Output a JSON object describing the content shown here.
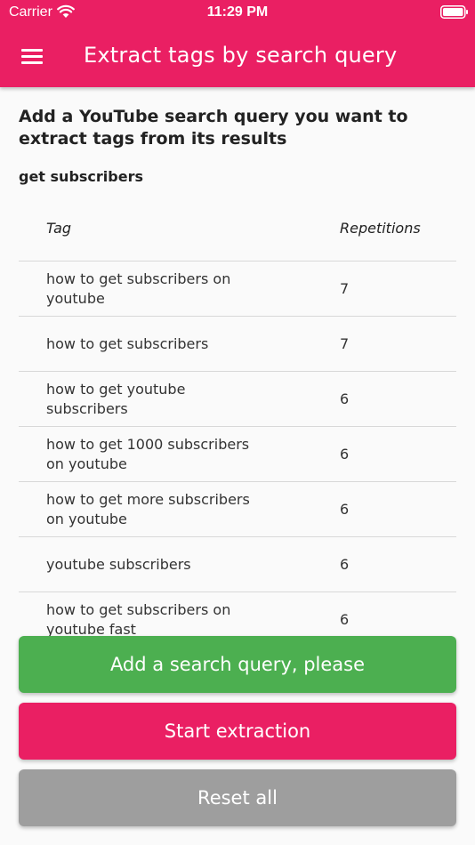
{
  "status_bar": {
    "carrier": "Carrier",
    "time": "11:29 PM",
    "icons": [
      "wifi-icon",
      "battery-icon"
    ]
  },
  "app_bar": {
    "menu_icon": "menu-icon",
    "title": "Extract tags by search query",
    "color": "#ea1f63"
  },
  "main": {
    "instruction": "Add a YouTube search query you want to extract tags from its results",
    "query": "get subscribers",
    "table": {
      "headers": {
        "tag": "Tag",
        "repetitions": "Repetitions"
      },
      "rows": [
        {
          "tag": "how to get subscribers on youtube",
          "repetitions": "7"
        },
        {
          "tag": "how to get subscribers",
          "repetitions": "7"
        },
        {
          "tag": "how to get youtube subscribers",
          "repetitions": "6"
        },
        {
          "tag": "how to get 1000 subscribers on youtube",
          "repetitions": "6"
        },
        {
          "tag": "how to get more subscribers on youtube",
          "repetitions": "6"
        },
        {
          "tag": "youtube subscribers",
          "repetitions": "6"
        },
        {
          "tag": "how to get subscribers on youtube fast",
          "repetitions": "6"
        }
      ]
    }
  },
  "buttons": {
    "add_query": {
      "label": "Add a search query, please",
      "color": "#4caf50"
    },
    "start": {
      "label": "Start extraction",
      "color": "#ea1f63"
    },
    "reset": {
      "label": "Reset all",
      "color": "#9e9e9e"
    }
  }
}
